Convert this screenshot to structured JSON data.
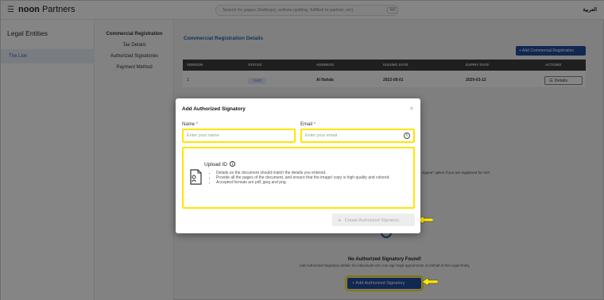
{
  "topbar": {
    "brand": "noon",
    "brand_suffix": "Partners",
    "search_placeholder": "Search for pages (Settings), actions (adding, fulfilled to partner, etc)",
    "search_shortcut": "⌘K",
    "language_link": "العربية"
  },
  "left_nav": {
    "title": "Legal Entities",
    "items": [
      "The Lion"
    ]
  },
  "sub_nav": {
    "items": [
      {
        "label": "Commercial Registration",
        "active": true
      },
      {
        "label": "Tax Details"
      },
      {
        "label": "Authorized Signatories"
      },
      {
        "label": "Payment Method"
      }
    ]
  },
  "content": {
    "title": "Commercial Registration Details",
    "add_cr_button": "+ Add Commercial Registration",
    "table": {
      "headers": [
        "VERSION",
        "STATUS",
        "ADDRESS",
        "ISSUING DATE",
        "EXPIRY DATE",
        "ACTIONS"
      ],
      "rows": [
        {
          "version": "1",
          "status": "Valid",
          "address": "Al Rahda",
          "issuing_date": "2022-08-01",
          "expiry_date": "2029-03-12",
          "action": "Details"
        }
      ]
    },
    "bg_note": "signee\" option if you are registered for VAT.",
    "empty_state": {
      "title": "No Authorized Signatory Found!",
      "description": "Add Authorized Signatory details for individuals who can sign legal agreements on behalf of the Legal Entity.",
      "button": "+ Add Authorized Signatory"
    }
  },
  "modal": {
    "title": "Add Authorized Signatory",
    "close_label": "×",
    "name": {
      "label": "Name",
      "required_mark": "*",
      "placeholder": "Enter your name",
      "value": ""
    },
    "email": {
      "label": "Email",
      "required_mark": "*",
      "placeholder": "Enter your email",
      "value": ""
    },
    "upload": {
      "title": "Upload ID",
      "info_glyph": "i",
      "bullets": [
        "Details on the document should match the details you entered.",
        "Provide all the pages of the document, and ensure that the image/ copy is high quality and colored.",
        "Accepted formats are pdf, jpeg and png."
      ]
    },
    "create_button": {
      "plus": "+",
      "label": "Create Authorized Signatory",
      "enabled": false
    }
  },
  "annotations": {
    "highlight_color": "#ffe500",
    "arrow_color": "#ffe500"
  },
  "colors": {
    "brand_blue": "#1f4e9e",
    "link_blue": "#2a5ea6"
  }
}
